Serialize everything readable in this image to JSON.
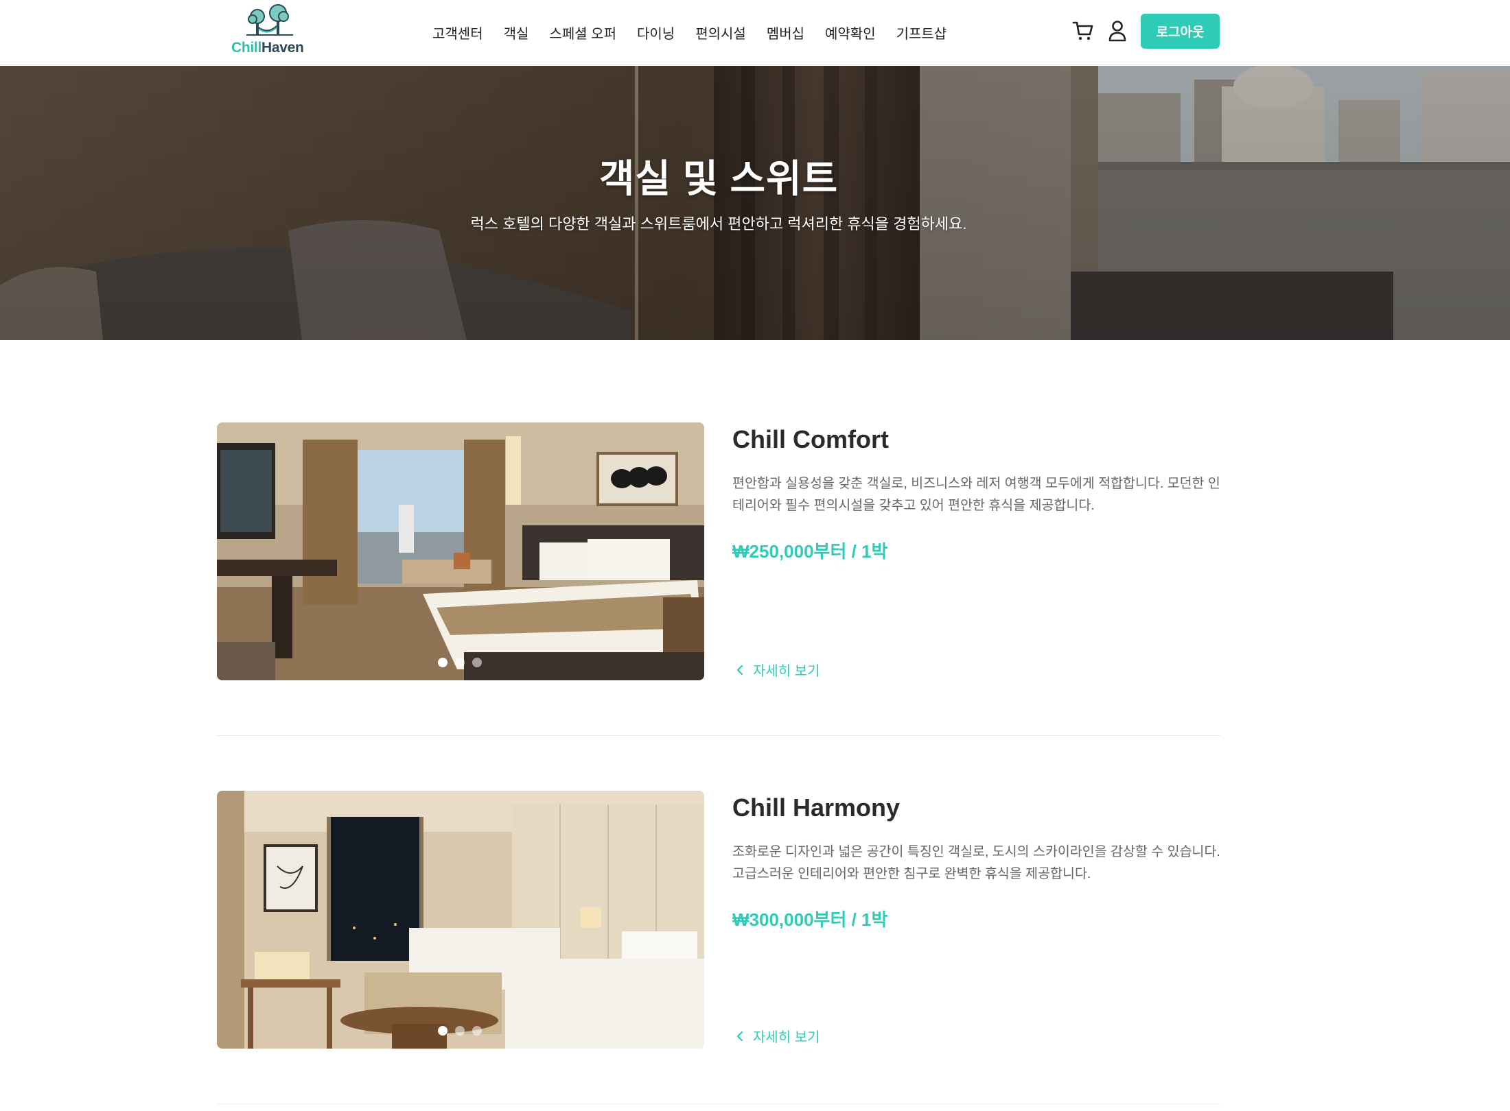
{
  "brand": {
    "name_part1": "Chill",
    "name_part2": "Haven"
  },
  "nav": {
    "items": [
      "고객센터",
      "객실",
      "스페셜 오퍼",
      "다이닝",
      "편의시설",
      "멤버십",
      "예약확인",
      "기프트샵"
    ]
  },
  "header": {
    "logout_label": "로그아웃",
    "cart_icon": "cart-icon",
    "user_icon": "user-icon"
  },
  "hero": {
    "title": "객실 및 스위트",
    "subtitle": "럭스 호텔의 다양한 객실과 스위트룸에서 편안하고 럭셔리한 휴식을 경험하세요."
  },
  "rooms": [
    {
      "name": "Chill Comfort",
      "description": "편안함과 실용성을 갖춘 객실로, 비즈니스와 레저 여행객 모두에게 적합합니다. 모던한 인테리어와 필수 편의시설을 갖추고 있어 편안한 휴식을 제공합니다.",
      "price": "₩250,000부터 / 1박",
      "detail_label": "자세히 보기",
      "slides": 3,
      "active_slide": 1
    },
    {
      "name": "Chill Harmony",
      "description": "조화로운 디자인과 넓은 공간이 특징인 객실로, 도시의 스카이라인을 감상할 수 있습니다. 고급스러운 인테리어와 편안한 침구로 완벽한 휴식을 제공합니다.",
      "price": "₩300,000부터 / 1박",
      "detail_label": "자세히 보기",
      "slides": 3,
      "active_slide": 1
    }
  ],
  "colors": {
    "accent": "#2ecbb7",
    "logo_dark": "#2a4a57",
    "text": "#222222",
    "muted": "#666666"
  }
}
